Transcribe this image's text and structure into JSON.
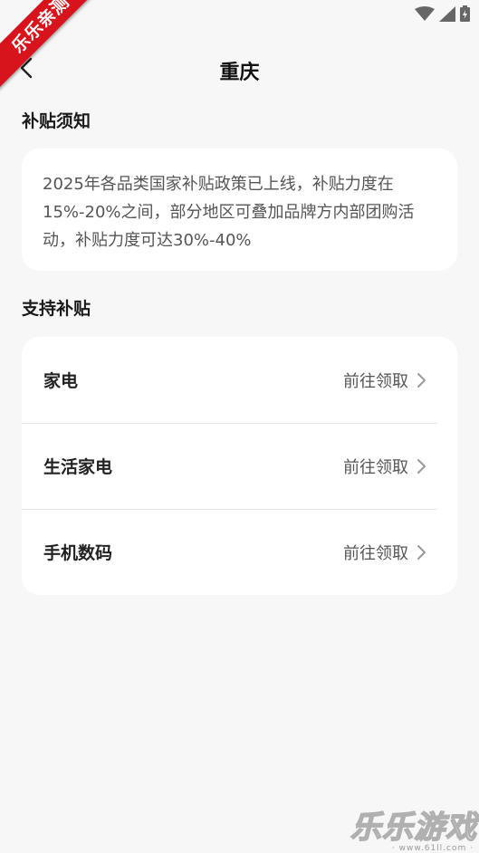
{
  "status_bar": {
    "icons": [
      "wifi-icon",
      "signal-icon",
      "battery-icon"
    ]
  },
  "ribbon": {
    "label": "乐乐亲测"
  },
  "header": {
    "title": "重庆",
    "back_icon": "chevron-left-icon"
  },
  "notice": {
    "section_title": "补贴须知",
    "text": "2025年各品类国家补贴政策已上线，补贴力度在15%-20%之间，部分地区可叠加品牌方内部团购活动，补贴力度可达30%-40%"
  },
  "subsidies": {
    "section_title": "支持补贴",
    "items": [
      {
        "label": "家电",
        "action": "前往领取"
      },
      {
        "label": "生活家电",
        "action": "前往领取"
      },
      {
        "label": "手机数码",
        "action": "前往领取"
      }
    ]
  },
  "watermark": {
    "title": "乐乐游戏",
    "url": "· www.61ll.com ·"
  },
  "colors": {
    "background": "#f7f7f7",
    "card": "#ffffff",
    "ribbon": "#d7141c",
    "secondary_text": "#555555"
  }
}
